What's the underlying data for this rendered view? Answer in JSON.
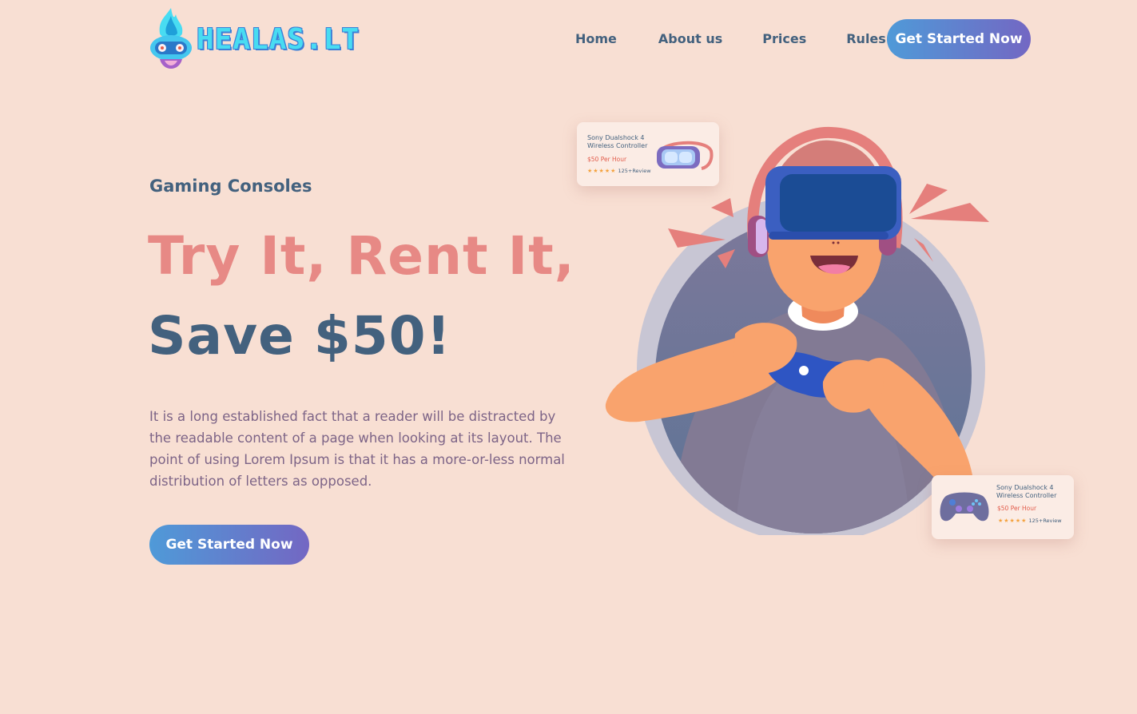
{
  "header": {
    "logo_text": "HEALAS.LT",
    "nav": [
      {
        "label": "Home"
      },
      {
        "label": "About us"
      },
      {
        "label": "Prices"
      },
      {
        "label": "Rules"
      }
    ],
    "cta_label": "Get Started Now"
  },
  "hero": {
    "eyebrow": "Gaming Consoles",
    "headline_line1": "Try It, Rent It,",
    "headline_line2": "Save $50!",
    "description": "It is a long established fact that a reader will be distracted by the readable content of a page when looking at its layout. The point of using Lorem Ipsum is that it has a more-or-less normal distribution of letters as opposed.",
    "cta_label": "Get Started Now"
  },
  "cards": [
    {
      "title": "Sony Dualshock 4 Wireless Controller",
      "price": "$50 Per Hour",
      "stars": "★★★★★",
      "reviews": "125+Review",
      "icon": "vr-headset-icon"
    },
    {
      "title": "Sony Dualshock 4 Wireless Controller",
      "price": "$50 Per Hour",
      "stars": "★★★★★",
      "reviews": "125+Review",
      "icon": "gamepad-icon"
    }
  ],
  "colors": {
    "background": "#f8dfd3",
    "primary_text": "#43617e",
    "accent_coral": "#e78985",
    "button_gradient_start": "#4f9ad8",
    "button_gradient_end": "#7367c3",
    "body_text": "#7d6487"
  }
}
